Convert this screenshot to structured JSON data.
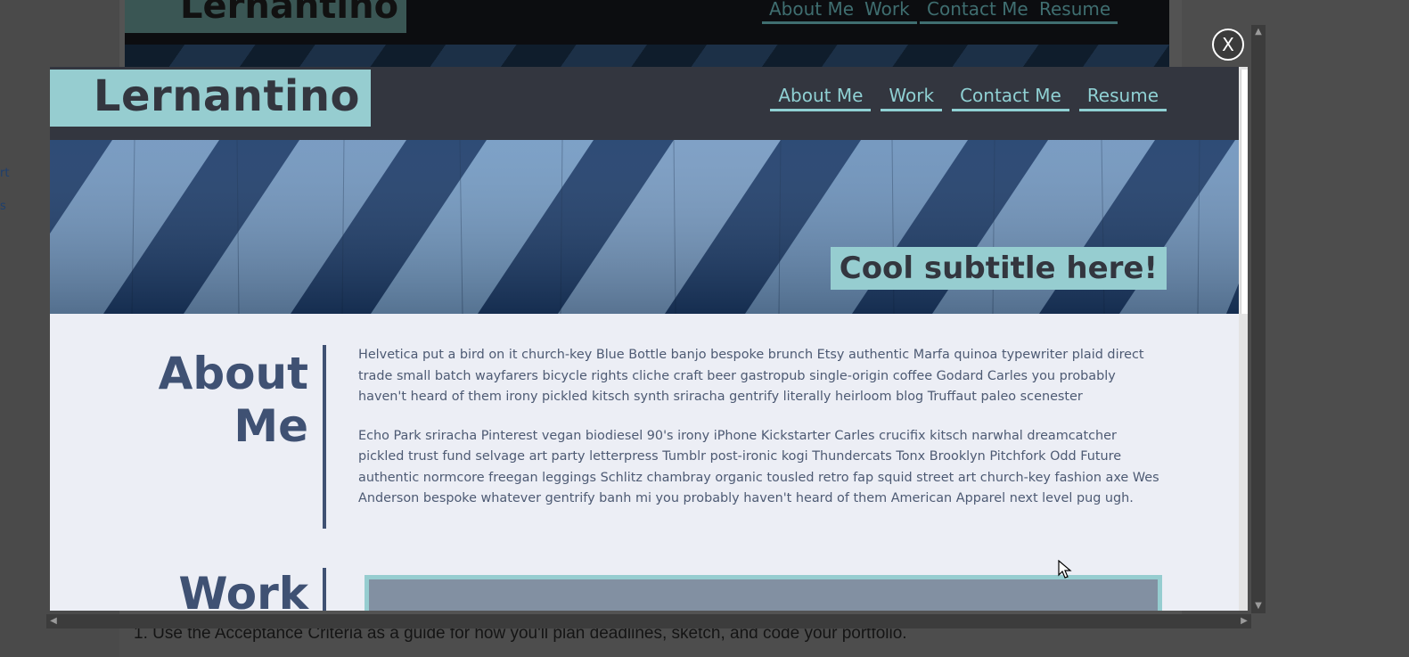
{
  "background": {
    "left_snippets": [
      "rt",
      "s"
    ],
    "logo": "Lernantino",
    "nav": [
      "About Me",
      "Work",
      "Contact Me",
      "Resume"
    ],
    "bottom_text": "1. Use the Acceptance Criteria as a guide for how you'll plan deadlines, sketch, and code your portfolio."
  },
  "viewer": {
    "close_label": "X"
  },
  "site": {
    "logo": "Lernantino",
    "nav": [
      "About Me",
      "Work",
      "Contact Me",
      "Resume"
    ],
    "subtitle": "Cool subtitle here!",
    "about": {
      "heading": "About Me",
      "paragraphs": [
        "Helvetica put a bird on it church-key Blue Bottle banjo bespoke brunch Etsy authentic Marfa quinoa typewriter plaid direct trade small batch wayfarers bicycle rights cliche craft beer gastropub single-origin coffee Godard Carles you probably haven't heard of them irony pickled kitsch synth sriracha gentrify literally heirloom blog Truffaut paleo scenester",
        "Echo Park sriracha Pinterest vegan biodiesel 90's irony iPhone Kickstarter Carles crucifix kitsch narwhal dreamcatcher pickled trust fund selvage art party letterpress Tumblr post-ironic kogi Thundercats Tonx Brooklyn Pitchfork Odd Future authentic normcore freegan leggings Schlitz chambray organic tousled retro fap squid street art church-key fashion axe Wes Anderson bespoke whatever gentrify banh mi you probably haven't heard of them American Apparel next level pug ugh."
      ]
    },
    "work": {
      "heading": "Work"
    }
  },
  "colors": {
    "header_bg": "#33363f",
    "accent": "#96cdd0",
    "heading": "#3f5173",
    "content_bg": "#eceef5"
  },
  "icons": {
    "close": "close-icon",
    "scroll_up": "chevron-up-icon",
    "scroll_down": "chevron-down-icon",
    "scroll_left": "chevron-left-icon",
    "scroll_right": "chevron-right-icon",
    "cursor": "mouse-pointer-icon"
  }
}
